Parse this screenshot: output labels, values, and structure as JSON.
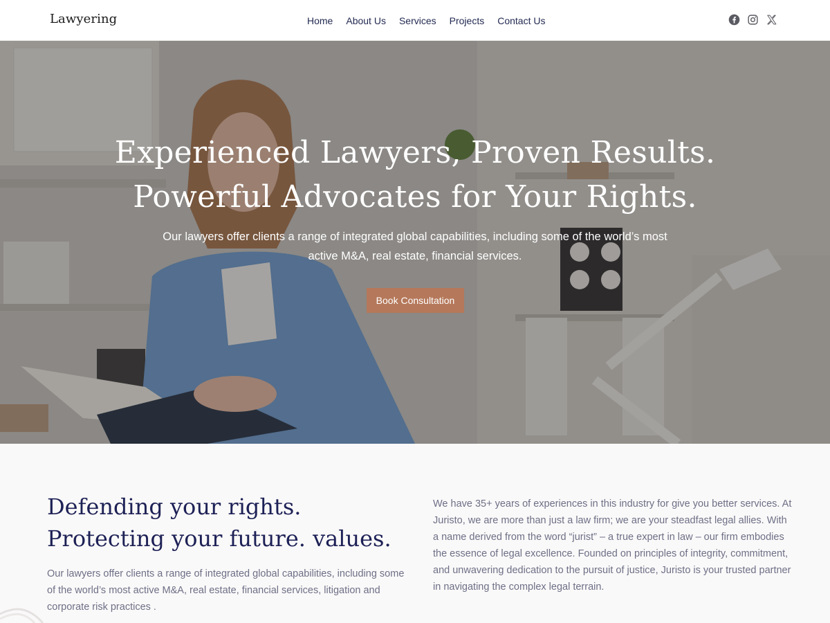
{
  "header": {
    "logo": "Lawyering",
    "nav": [
      "Home",
      "About Us",
      "Services",
      "Projects",
      "Contact Us"
    ],
    "social_icons": [
      "facebook-icon",
      "instagram-icon",
      "x-icon"
    ]
  },
  "hero": {
    "title_line1": "Experienced Lawyers, Proven Results.",
    "title_line2": "Powerful Advocates for Your Rights.",
    "subtitle": "Our lawyers offer clients a range of integrated global capabilities, including some of the world’s most active M&A, real estate, financial services.",
    "cta_label": "Book Consultation",
    "cta_color": "#b5785a"
  },
  "about": {
    "heading": "Defending your rights. Protecting your future. values.",
    "left_text": "Our lawyers offer clients a range of integrated global capabilities, including some of the world’s most active M&A, real estate, financial services, litigation and corporate risk practices .",
    "right_text": "We have 35+ years of experiences in this industry for give you better services. At Juristo, we are more than just a law firm; we are your steadfast legal allies. With a name derived from the word “jurist” – a true expert in law – our firm embodies the essence of legal excellence. Founded on principles of integrity, commitment, and unwavering dedication to the pursuit of justice, Juristo is your trusted partner in navigating the complex legal terrain."
  },
  "colors": {
    "heading": "#1d2156",
    "body_text": "#6d6f86",
    "accent": "#b5785a"
  }
}
